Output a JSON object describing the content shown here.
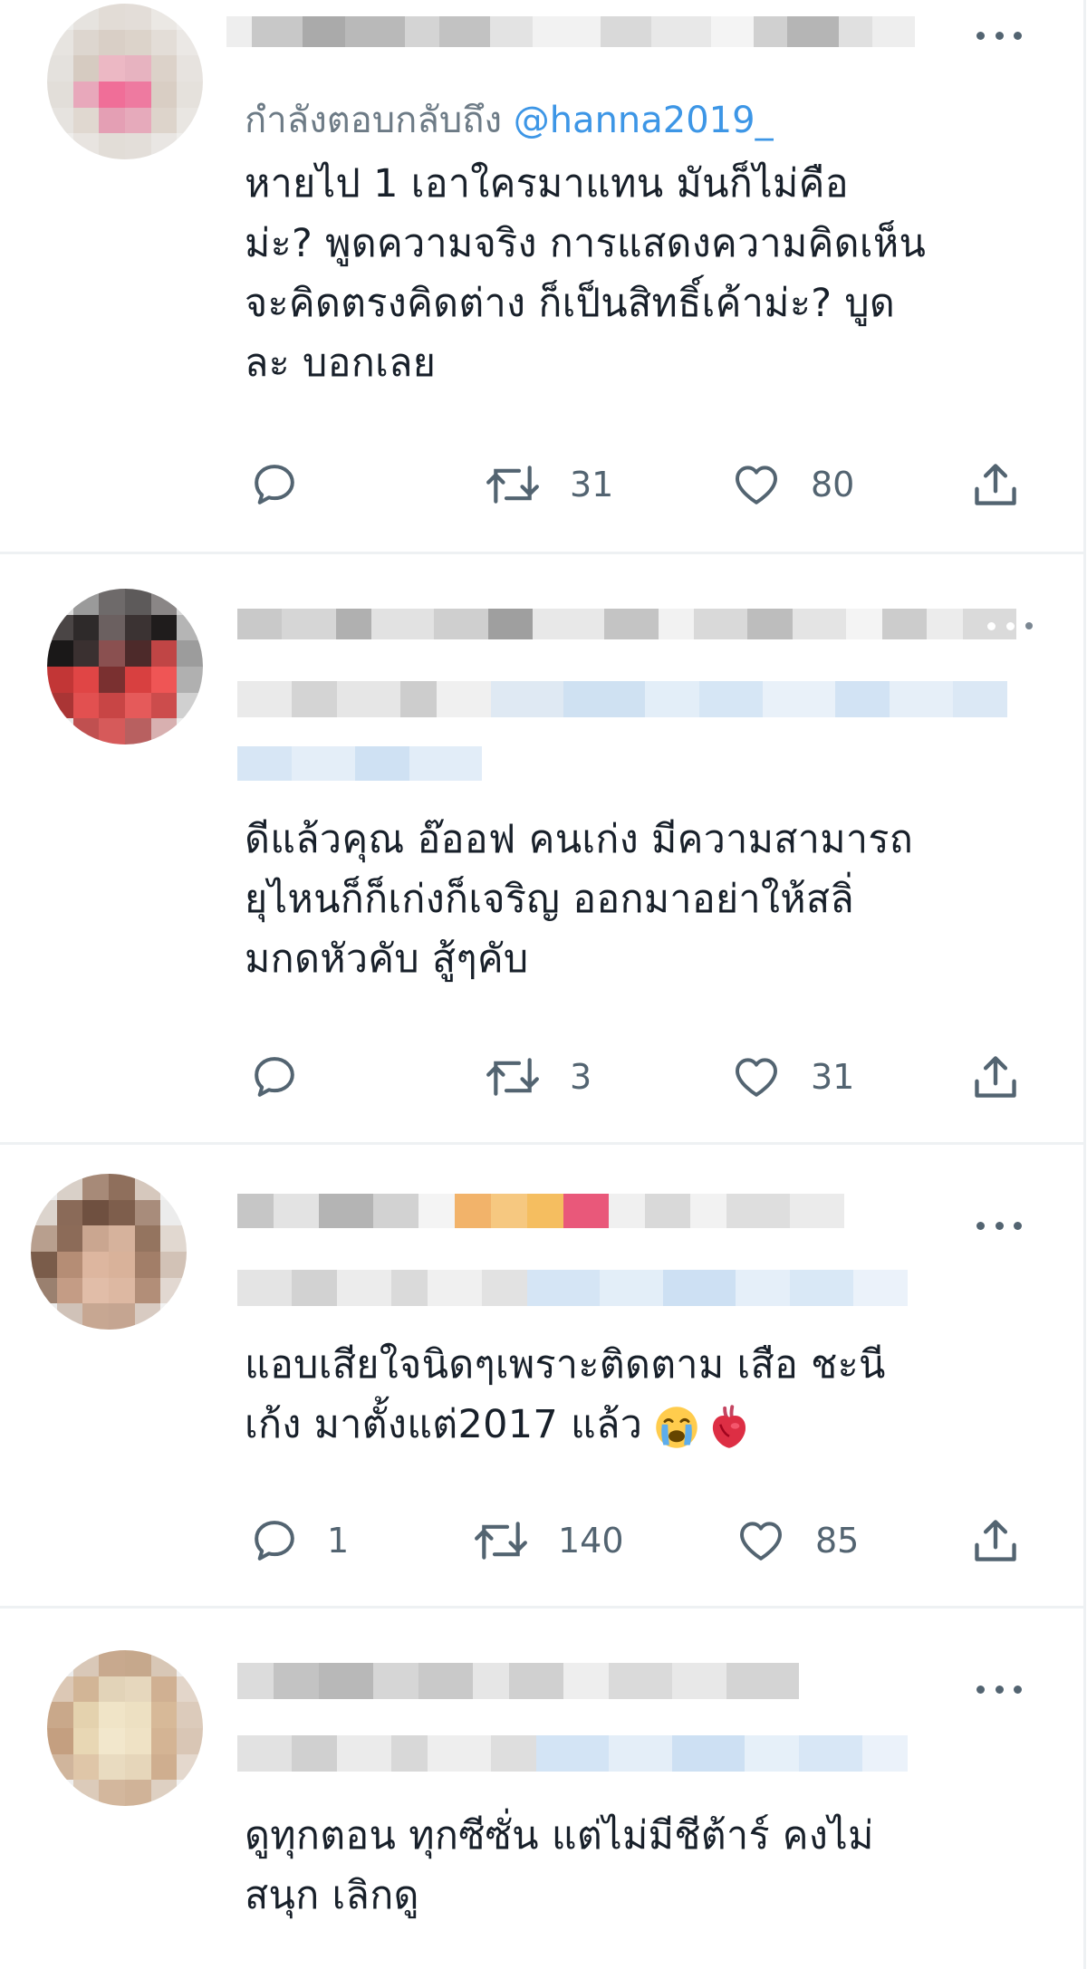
{
  "colors": {
    "text": "#0f1419",
    "secondary": "#536471",
    "link": "#1d9bf0",
    "divider": "#eff3f4"
  },
  "icons": [
    "reply-icon",
    "retweet-icon",
    "like-icon",
    "share-icon",
    "more-icon"
  ],
  "tweets": [
    {
      "reply_prefix": "กำลังตอบกลับถึง",
      "reply_handle": "@hanna2019_",
      "text": "หายไป 1 เอาใครมาแทน มันก็ไม่คือ\nม่ะ? พูดความจริง การแสดงความคิดเห็น\nจะคิดตรงคิดต่าง ก็เป็นสิทธิ์เค้าม่ะ? บูด\nละ บอกเลย",
      "reply_count": "",
      "retweet_count": "31",
      "like_count": "80"
    },
    {
      "text": "ดีแล้วคุณ อ๊ออฟ คนเก่ง มีความสามารถ\nยุไหนก็ก็เก่งก็เจริญ ออกมาอย่าให้สลิ่\nมกดหัวคับ สู้ๆคับ",
      "reply_count": "",
      "retweet_count": "3",
      "like_count": "31"
    },
    {
      "text": "แอบเสียใจนิดๆเพราะติดตาม เสือ ชะนี\nเก้ง มาตั้งแต่2017 แล้ว",
      "emojis": [
        "crying-face-emoji",
        "anatomical-heart-emoji"
      ],
      "reply_count": "1",
      "retweet_count": "140",
      "like_count": "85"
    },
    {
      "text": "ดูทุกตอน ทุกซีซั่น แต่ไม่มีชีต้าร์ คงไม่\nสนุก เลิกดู"
    }
  ]
}
